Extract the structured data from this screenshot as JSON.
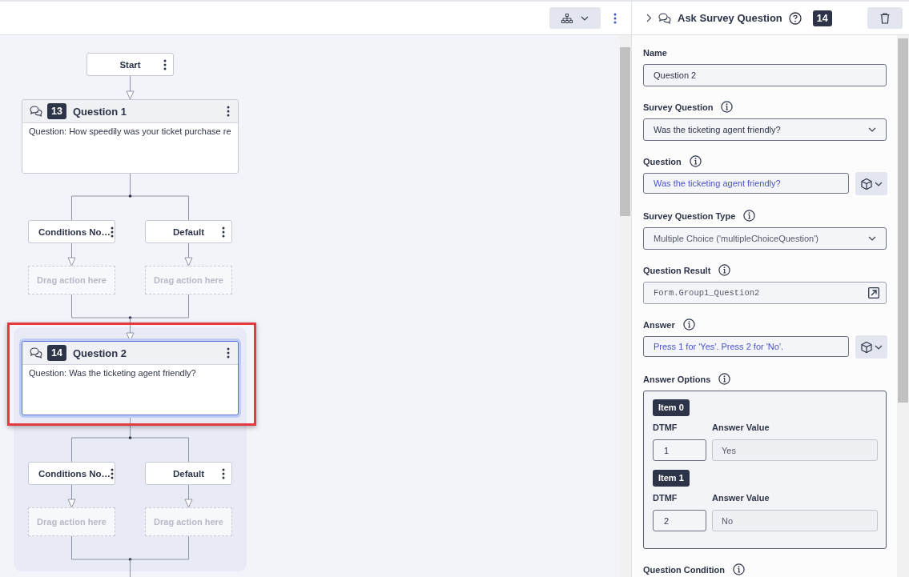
{
  "flow": [
    {
      "kind": "start",
      "label": "Start"
    },
    {
      "kind": "action",
      "number": "13",
      "title": "Question 1",
      "body": "Question: How speedily was your ticket purchase re",
      "selected": false,
      "annotated": false,
      "paths": [
        {
          "label": "Conditions No…",
          "drop_zone": "Drag action here"
        },
        {
          "label": "Default",
          "drop_zone": "Drag action here"
        }
      ]
    },
    {
      "kind": "action",
      "number": "14",
      "title": "Question 2",
      "body": "Question: Was the ticketing agent friendly?",
      "selected": true,
      "annotated": true,
      "paths": [
        {
          "label": "Conditions No…",
          "drop_zone": "Drag action here"
        },
        {
          "label": "Default",
          "drop_zone": "Drag action here"
        }
      ]
    }
  ],
  "panel": {
    "title": "Ask Survey Question",
    "number": "14",
    "fields": [
      {
        "kind": "text",
        "label": "Name",
        "info": false,
        "value": "Question 2"
      },
      {
        "kind": "select",
        "label": "Survey Question",
        "info": true,
        "value": "Was the ticketing agent friendly?"
      },
      {
        "kind": "expression",
        "label": "Question",
        "info": true,
        "value": "Was the ticketing agent friendly?"
      },
      {
        "kind": "select",
        "label": "Survey Question Type",
        "info": true,
        "value": "Multiple Choice ('multipleChoiceQuestion')"
      },
      {
        "kind": "variable",
        "label": "Question Result",
        "info": true,
        "value": "Form.Group1_Question2"
      },
      {
        "kind": "expression",
        "label": "Answer",
        "info": true,
        "value": "Press 1 for 'Yes'. Press 2 for 'No'."
      },
      {
        "kind": "options",
        "label": "Answer Options",
        "info": true,
        "items": [
          {
            "title": "Item 0",
            "dtmf_label": "DTMF",
            "value_label": "Answer Value",
            "dtmf": "1",
            "value": "Yes"
          },
          {
            "title": "Item 1",
            "dtmf_label": "DTMF",
            "value_label": "Answer Value",
            "dtmf": "2",
            "value": "No"
          }
        ]
      },
      {
        "kind": "label",
        "label": "Question Condition",
        "info": true
      }
    ]
  }
}
